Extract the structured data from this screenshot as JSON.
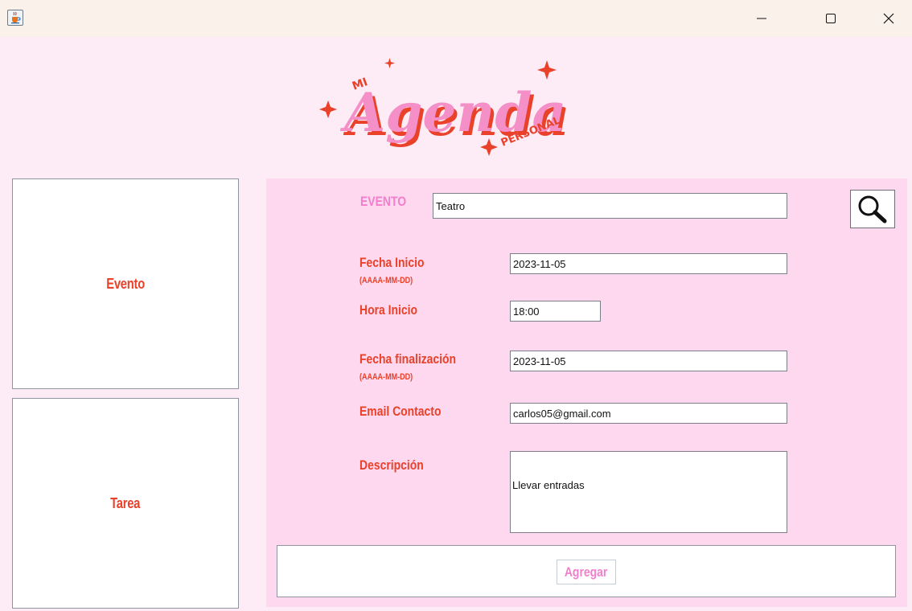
{
  "window": {
    "icon": "java-cup-icon",
    "controls": [
      "minimize-icon",
      "maximize-icon",
      "close-icon"
    ]
  },
  "logo": {
    "top_text": "MI",
    "main_text": "Agenda",
    "bottom_text": "PERSONAL",
    "colors": {
      "main": "#f48fc7",
      "shadow": "#e9412a"
    }
  },
  "sidebar": {
    "evento_label": "Evento",
    "tarea_label": "Tarea"
  },
  "form": {
    "evento_label": "EVENTO",
    "evento_value": "Teatro",
    "fecha_inicio_label": "Fecha Inicio",
    "fecha_inicio_hint": "(AAAA-MM-DD)",
    "fecha_inicio_value": "2023-11-05",
    "hora_inicio_label": "Hora Inicio",
    "hora_inicio_value": "18:00",
    "fecha_fin_label": "Fecha finalización",
    "fecha_fin_hint": "(AAAA-MM-DD)",
    "fecha_fin_value": "2023-11-05",
    "email_label": "Email Contacto",
    "email_value": "carlos05@gmail.com",
    "descripcion_label": "Descripción",
    "descripcion_value": "Llevar entradas",
    "search_icon": "search-icon",
    "add_label": "Agregar"
  },
  "colors": {
    "background": "#fdebf6",
    "panel": "#fdd8ef",
    "label_red": "#e9412a",
    "label_pink": "#f27fcc",
    "titlebar": "#faf1ea"
  }
}
